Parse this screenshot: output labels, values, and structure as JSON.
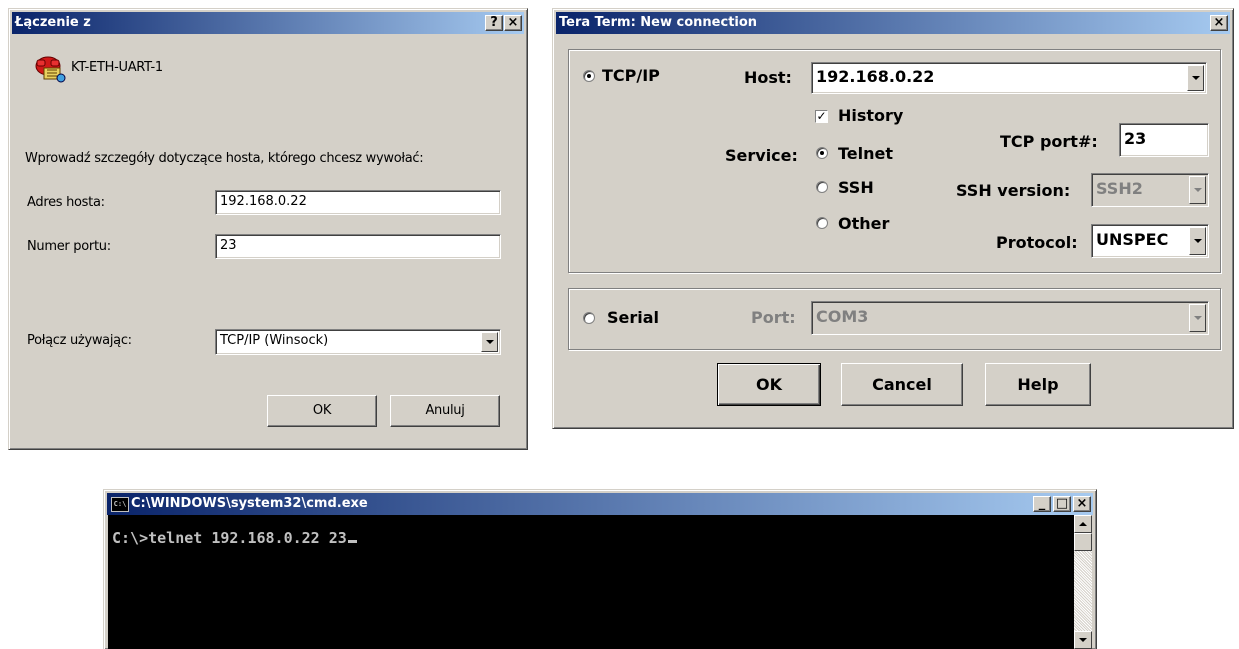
{
  "telnet_dialog": {
    "title": "Łączenie z",
    "help_glyph": "?",
    "close_glyph": "×",
    "connection_name": "KT-ETH-UART-1",
    "instruction": "Wprowadź szczegóły dotyczące hosta, którego chcesz wywołać:",
    "host_label": "Adres hosta:",
    "host_value": "192.168.0.22",
    "port_label": "Numer portu:",
    "port_value": "23",
    "connect_using_label": "Połącz używając:",
    "connect_using_value": "TCP/IP (Winsock)",
    "ok_label": "OK",
    "cancel_label": "Anuluj"
  },
  "teraterm_dialog": {
    "title": "Tera Term: New connection",
    "close_glyph": "×",
    "tcpip_label": "TCP/IP",
    "tcpip_selected": true,
    "host_label": "Host:",
    "host_value": "192.168.0.22",
    "history_label": "History",
    "history_checked": true,
    "service_label": "Service:",
    "service_options": [
      "Telnet",
      "SSH",
      "Other"
    ],
    "service_selected": "Telnet",
    "tcp_port_label": "TCP port#:",
    "tcp_port_value": "23",
    "ssh_version_label": "SSH version:",
    "ssh_version_value": "SSH2",
    "protocol_label": "Protocol:",
    "protocol_value": "UNSPEC",
    "serial_label": "Serial",
    "port_label": "Port:",
    "port_value": "COM3",
    "ok_label": "OK",
    "cancel_label": "Cancel",
    "help_label": "Help"
  },
  "cmd_window": {
    "title": "C:\\WINDOWS\\system32\\cmd.exe",
    "icon_text": "C:\\",
    "minimize_glyph": "_",
    "maximize_glyph": "□",
    "close_glyph": "×",
    "command_line": "C:\\>telnet 192.168.0.22 23"
  }
}
